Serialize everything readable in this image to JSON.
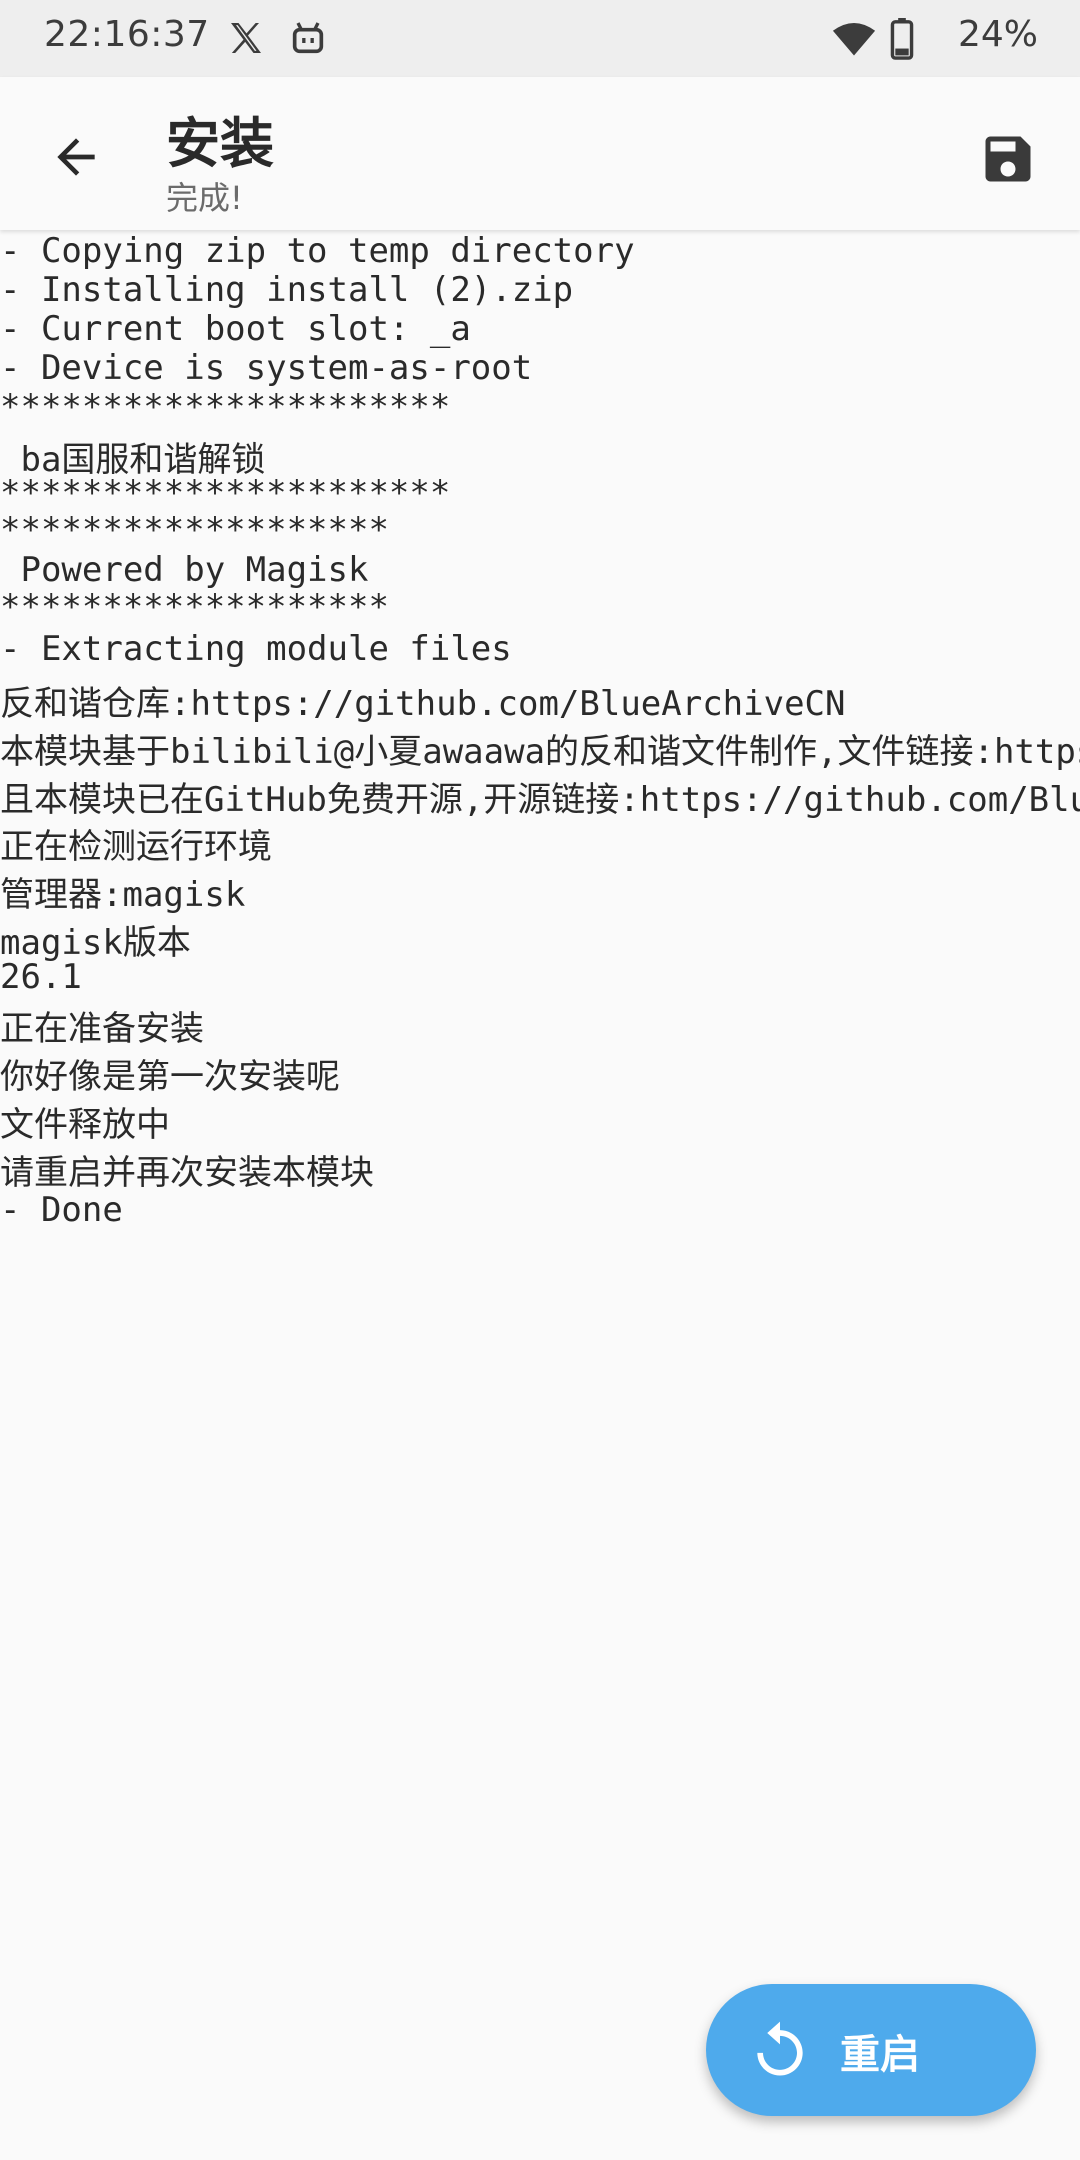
{
  "status_bar": {
    "time": "22:16:37",
    "battery": "24%",
    "icons": [
      "x-icon",
      "android-bot-icon",
      "wifi-icon",
      "battery-icon"
    ]
  },
  "app_bar": {
    "title": "安装",
    "subtitle": "完成!",
    "back_icon": "arrow-back-icon",
    "save_icon": "save-icon"
  },
  "console": {
    "lines": [
      "- Copying zip to temp directory",
      "- Installing install (2).zip",
      "- Current boot slot: _a",
      "- Device is system-as-root",
      "**********************",
      " ba国服和谐解锁",
      "**********************",
      "*******************",
      " Powered by Magisk",
      "*******************",
      "- Extracting module files",
      "反和谐仓库:https://github.com/BlueArchiveCN",
      "本模块基于bilibili@小夏awaawa的反和谐文件制作,文件链接:https:/",
      "且本模块已在GitHub免费开源,开源链接:https://github.com/BlueA",
      "正在检测运行环境",
      "管理器:magisk",
      "magisk版本",
      "26.1",
      "正在准备安装",
      "你好像是第一次安装呢",
      "文件释放中",
      "请重启并再次安装本模块",
      "- Done"
    ]
  },
  "fab": {
    "label": "重启",
    "icon": "restart-icon"
  },
  "colors": {
    "status_bar_bg": "#eeeeee",
    "background": "#fafafa",
    "fab": "#4eaaec"
  }
}
